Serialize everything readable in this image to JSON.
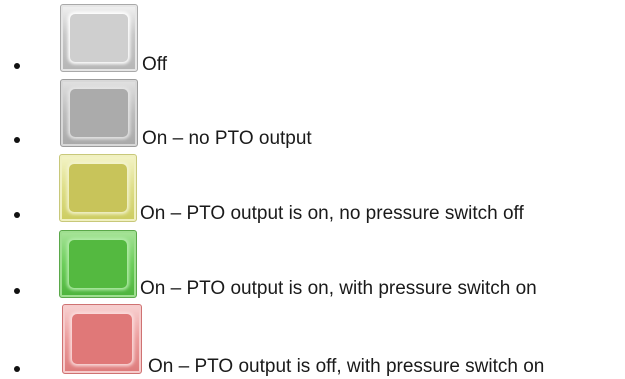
{
  "legend": {
    "items": [
      {
        "state": "off",
        "label": "Off",
        "color": "#cfcfcf"
      },
      {
        "state": "on-no-output",
        "label": "On – no PTO output",
        "color": "#ababab"
      },
      {
        "state": "on-output-no-pressure",
        "label": "On – PTO output is on, no pressure switch off",
        "color": "#c8c45a"
      },
      {
        "state": "on-output-pressure",
        "label": "On – PTO output is on, with pressure switch on",
        "color": "#54b940"
      },
      {
        "state": "off-output-pressure",
        "label": "On – PTO output is off, with pressure switch on",
        "color": "#e07878"
      }
    ]
  }
}
